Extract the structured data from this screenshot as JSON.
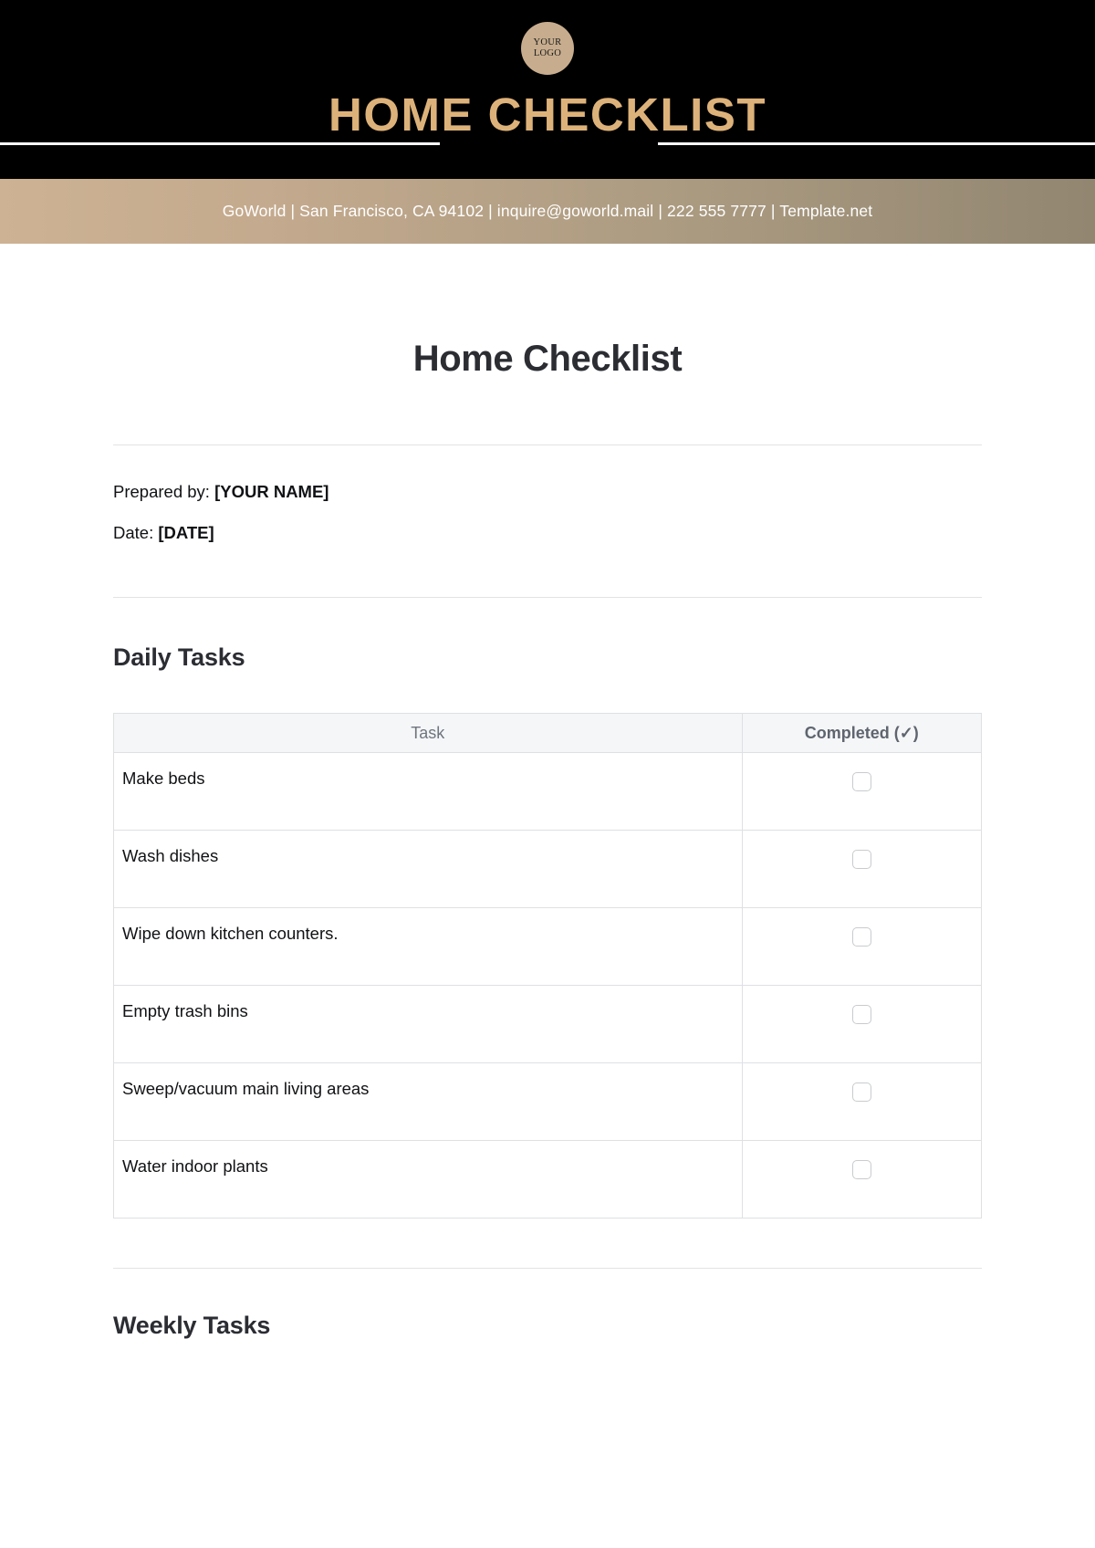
{
  "header": {
    "logo": {
      "line1": "YOUR",
      "line2": "LOGO"
    },
    "title": "HOME CHECKLIST",
    "background_color": "#000000",
    "title_color": "#ddb27a"
  },
  "contact_bar": {
    "text": "GoWorld | San Francisco, CA 94102 | inquire@goworld.mail | 222 555 7777 | Template.net",
    "gradient_from": "#cdb293",
    "gradient_to": "#928671",
    "text_color": "#ffffff"
  },
  "document": {
    "title": "Home Checklist",
    "prepared_by_label": "Prepared by:",
    "prepared_by_value": "[YOUR NAME]",
    "date_label": "Date:",
    "date_value": "[DATE]"
  },
  "daily_section": {
    "heading": "Daily Tasks",
    "columns": {
      "task": "Task",
      "completed": "Completed (✓)"
    },
    "rows": [
      {
        "task": "Make beds",
        "completed": false
      },
      {
        "task": "Wash dishes",
        "completed": false
      },
      {
        "task": "Wipe down kitchen counters.",
        "completed": false
      },
      {
        "task": "Empty trash bins",
        "completed": false
      },
      {
        "task": "Sweep/vacuum main living areas",
        "completed": false
      },
      {
        "task": "Water indoor plants",
        "completed": false
      }
    ]
  },
  "weekly_section": {
    "heading": "Weekly Tasks"
  }
}
